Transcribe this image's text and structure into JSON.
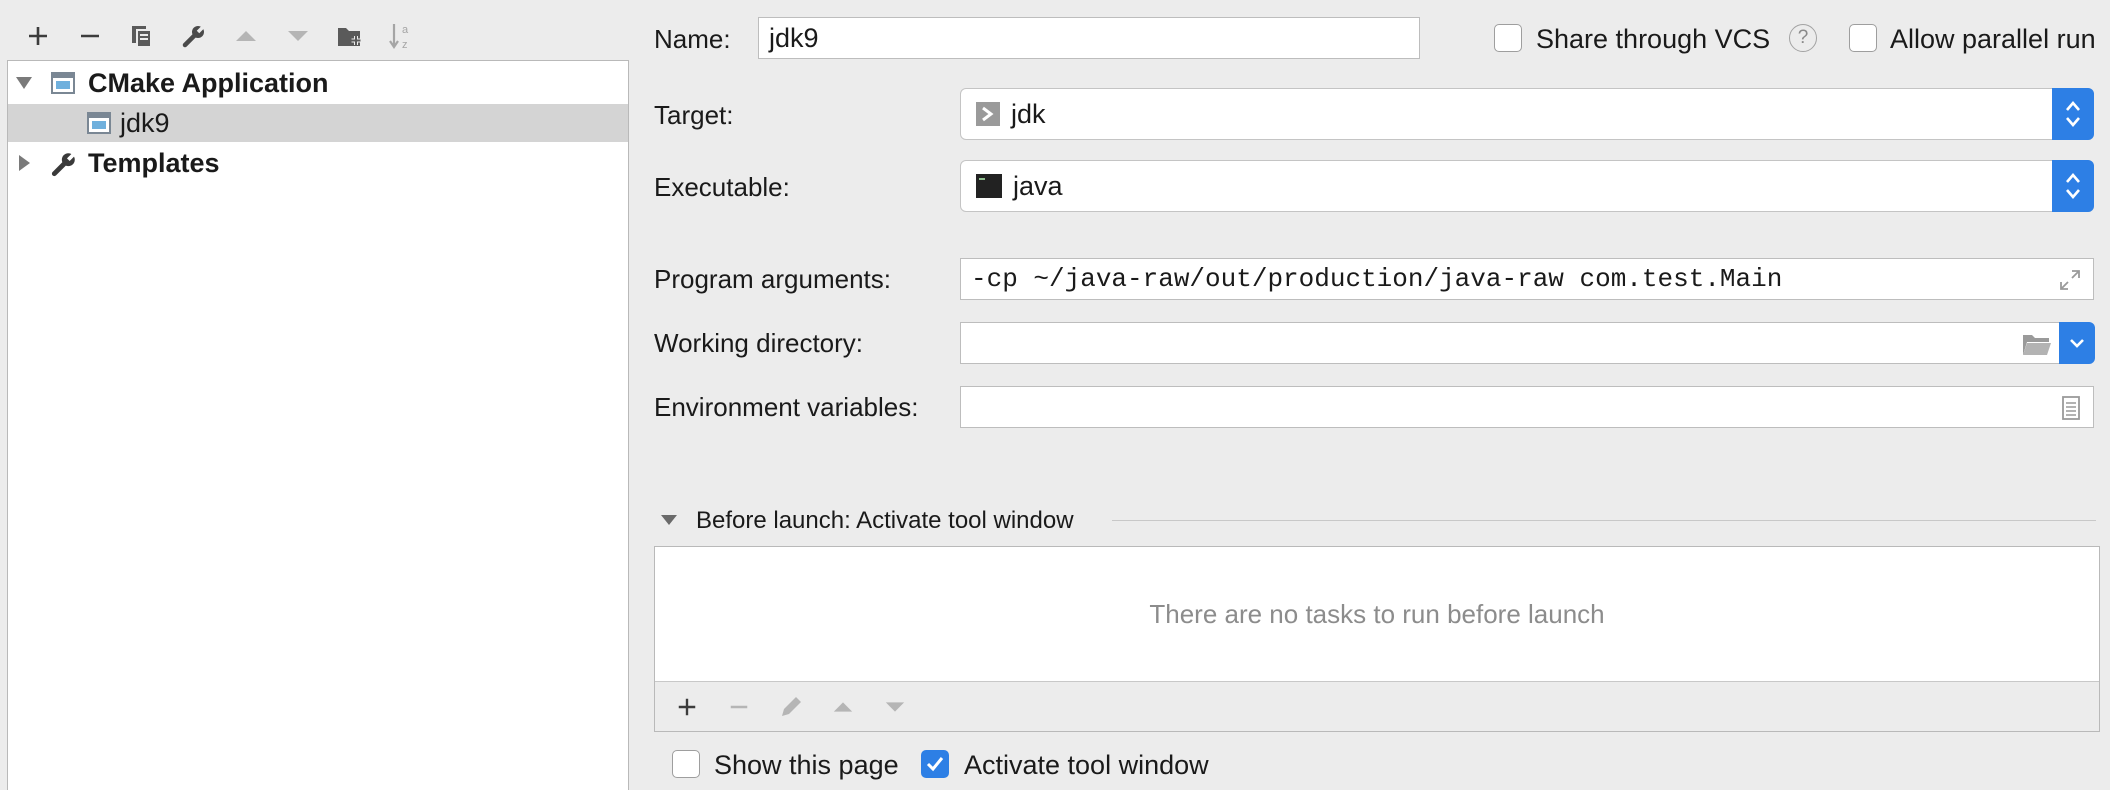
{
  "toolbar": {
    "icons": [
      "add-icon",
      "remove-icon",
      "copy-icon",
      "wrench-icon",
      "move-up-icon",
      "move-down-icon",
      "new-folder-icon",
      "sort-icon"
    ]
  },
  "tree": {
    "items": [
      {
        "label": "CMake Application",
        "icon": "cmake-app-icon",
        "expanded": true
      },
      {
        "label": "jdk9",
        "icon": "cmake-config-icon",
        "selected": true
      },
      {
        "label": "Templates",
        "icon": "wrench-icon",
        "expanded": false
      }
    ]
  },
  "form": {
    "name_label": "Name:",
    "name_value": "jdk9",
    "share_vcs_label": "Share through VCS",
    "share_vcs_checked": false,
    "help_glyph": "?",
    "allow_parallel_label": "Allow parallel run",
    "allow_parallel_checked": false,
    "target_label": "Target:",
    "target_value": "jdk",
    "executable_label": "Executable:",
    "executable_value": "java",
    "program_args_label": "Program arguments:",
    "program_args_value": "-cp ~/java-raw/out/production/java-raw com.test.Main",
    "working_dir_label": "Working directory:",
    "working_dir_value": "",
    "env_vars_label": "Environment variables:",
    "env_vars_value": ""
  },
  "before_launch": {
    "title": "Before launch: Activate tool window",
    "empty_text": "There are no tasks to run before launch",
    "toolbar_icons": [
      "add-icon",
      "remove-icon",
      "edit-icon",
      "move-up-icon",
      "move-down-icon"
    ],
    "show_page_label": "Show this page",
    "show_page_checked": false,
    "activate_label": "Activate tool window",
    "activate_checked": true
  },
  "colors": {
    "accent": "#2d7fe5",
    "background": "#ececec",
    "selection": "#d4d4d4"
  }
}
